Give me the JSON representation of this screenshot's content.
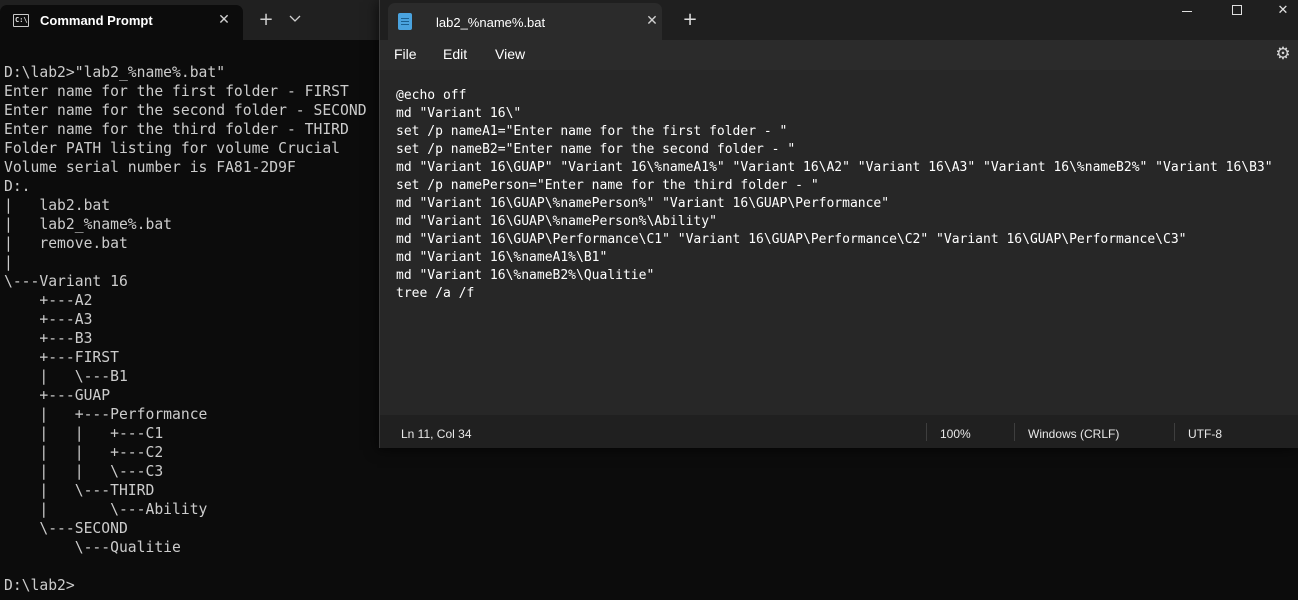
{
  "cmd": {
    "tab_title": "Command Prompt",
    "tab_close": "✕",
    "new_tab": "+",
    "dropdown": "⌄",
    "icon_text": "C:\\",
    "lines": [
      "D:\\lab2>\"lab2_%name%.bat\"",
      "Enter name for the first folder - FIRST",
      "Enter name for the second folder - SECOND",
      "Enter name for the third folder - THIRD",
      "Folder PATH listing for volume Crucial",
      "Volume serial number is FA81-2D9F",
      "D:.",
      "|   lab2.bat",
      "|   lab2_%name%.bat",
      "|   remove.bat",
      "|",
      "\\---Variant 16",
      "    +---A2",
      "    +---A3",
      "    +---B3",
      "    +---FIRST",
      "    |   \\---B1",
      "    +---GUAP",
      "    |   +---Performance",
      "    |   |   +---C1",
      "    |   |   +---C2",
      "    |   |   \\---C3",
      "    |   \\---THIRD",
      "    |       \\---Ability",
      "    \\---SECOND",
      "        \\---Qualitie",
      "",
      "D:\\lab2>"
    ]
  },
  "notepad": {
    "tab_title": "lab2_%name%.bat",
    "tab_close": "✕",
    "new_tab": "+",
    "window_controls": {
      "minimize": "",
      "maximize": "",
      "close": "✕"
    },
    "menu": {
      "file": "File",
      "edit": "Edit",
      "view": "View"
    },
    "settings_icon": "⚙",
    "lines": [
      "@echo off",
      "md \"Variant 16\\\"",
      "set /p nameA1=\"Enter name for the first folder - \"",
      "set /p nameB2=\"Enter name for the second folder - \"",
      "md \"Variant 16\\GUAP\" \"Variant 16\\%nameA1%\" \"Variant 16\\A2\" \"Variant 16\\A3\" \"Variant 16\\%nameB2%\" \"Variant 16\\B3\"",
      "set /p namePerson=\"Enter name for the third folder - \"",
      "md \"Variant 16\\GUAP\\%namePerson%\" \"Variant 16\\GUAP\\Performance\"",
      "md \"Variant 16\\GUAP\\%namePerson%\\Ability\"",
      "md \"Variant 16\\GUAP\\Performance\\C1\" \"Variant 16\\GUAP\\Performance\\C2\" \"Variant 16\\GUAP\\Performance\\C3\"",
      "md \"Variant 16\\%nameA1%\\B1\"",
      "md \"Variant 16\\%nameB2%\\Qualitie\"",
      "tree /a /f"
    ],
    "status": {
      "position": "Ln 11, Col 34",
      "zoom": "100%",
      "line_endings": "Windows (CRLF)",
      "encoding": "UTF-8"
    }
  }
}
